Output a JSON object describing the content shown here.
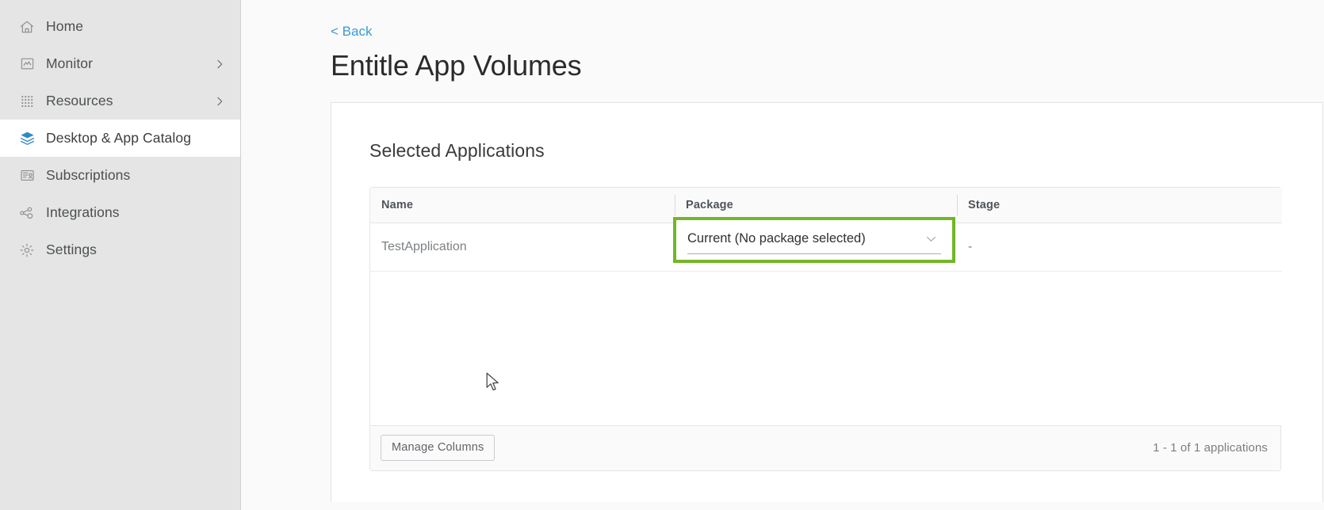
{
  "sidebar": {
    "items": [
      {
        "label": "Home",
        "icon": "home-icon",
        "expandable": false,
        "active": false
      },
      {
        "label": "Monitor",
        "icon": "monitor-icon",
        "expandable": true,
        "active": false
      },
      {
        "label": "Resources",
        "icon": "resources-icon",
        "expandable": true,
        "active": false
      },
      {
        "label": "Desktop & App Catalog",
        "icon": "layers-icon",
        "expandable": false,
        "active": true
      },
      {
        "label": "Subscriptions",
        "icon": "subscriptions-icon",
        "expandable": false,
        "active": false
      },
      {
        "label": "Integrations",
        "icon": "integrations-icon",
        "expandable": false,
        "active": false
      },
      {
        "label": "Settings",
        "icon": "gear-icon",
        "expandable": false,
        "active": false
      }
    ]
  },
  "main": {
    "back_label": "< Back",
    "page_title": "Entitle App Volumes",
    "section_title": "Selected Applications",
    "table": {
      "columns": [
        "Name",
        "Package",
        "Stage"
      ],
      "rows": [
        {
          "name": "TestApplication",
          "package": "Current (No package selected)",
          "stage": "-"
        }
      ],
      "footer": {
        "manage_columns_label": "Manage Columns",
        "pager_count": "1 - 1 of 1 applications"
      }
    }
  },
  "colors": {
    "accent_link": "#3d9ad1",
    "highlight_green": "#72b626",
    "sidebar_bg": "#e5e5e5",
    "active_icon": "#2e8ac4"
  }
}
